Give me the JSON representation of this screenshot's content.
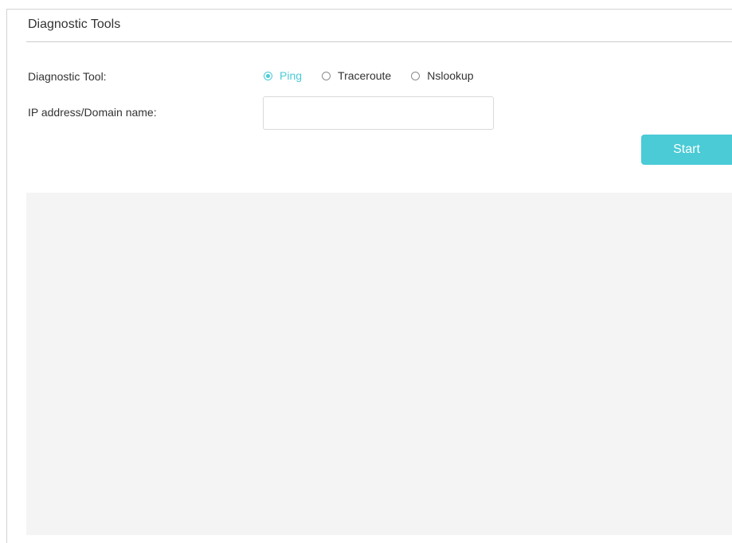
{
  "section": {
    "title": "Diagnostic Tools"
  },
  "form": {
    "tool_label": "Diagnostic Tool:",
    "ip_label": "IP address/Domain name:",
    "ip_value": "",
    "ip_placeholder": ""
  },
  "tools": {
    "selected": "Ping",
    "options": [
      {
        "label": "Ping",
        "checked": true
      },
      {
        "label": "Traceroute",
        "checked": false
      },
      {
        "label": "Nslookup",
        "checked": false
      }
    ]
  },
  "actions": {
    "start_label": "Start"
  },
  "output": {
    "text": ""
  },
  "colors": {
    "accent": "#4acbd6",
    "output_background": "#f4f4f4"
  }
}
